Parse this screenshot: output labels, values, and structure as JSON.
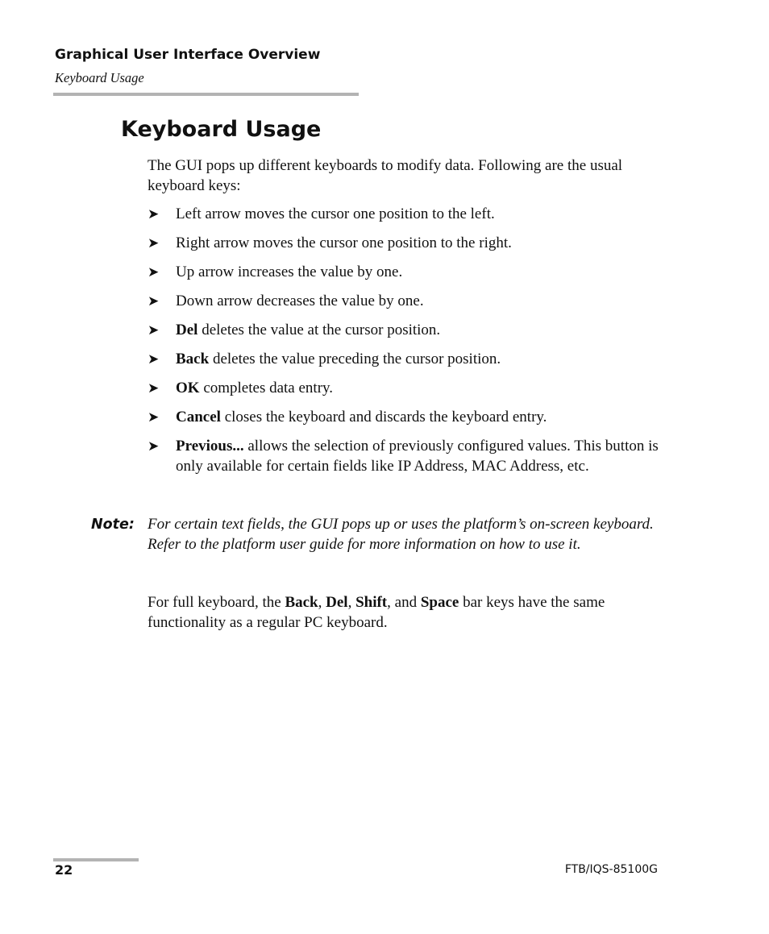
{
  "header": {
    "chapter": "Graphical User Interface Overview",
    "section": "Keyboard Usage"
  },
  "title": "Keyboard Usage",
  "intro": "The GUI pops up different keyboards to modify data. Following are the usual keyboard keys:",
  "bullet_icon": "arrowhead-right-icon",
  "bullets": [
    {
      "bold": "",
      "text": "Left arrow moves the cursor one position to the left."
    },
    {
      "bold": "",
      "text": "Right arrow moves the cursor one position to the right."
    },
    {
      "bold": "",
      "text": "Up arrow increases the value by one."
    },
    {
      "bold": "",
      "text": "Down arrow decreases the value by one."
    },
    {
      "bold": "Del",
      "text": " deletes the value at the cursor position."
    },
    {
      "bold": "Back",
      "text": " deletes the value preceding the cursor position."
    },
    {
      "bold": "OK",
      "text": " completes data entry."
    },
    {
      "bold": "Cancel",
      "text": " closes the keyboard and discards the keyboard entry."
    },
    {
      "bold": "Previous...",
      "text": " allows the selection of previously configured values. This button is only available for certain fields like IP Address, MAC Address, etc."
    }
  ],
  "note": {
    "label": "Note:",
    "text": "For certain text fields, the GUI pops up or uses the platform’s on-screen keyboard. Refer to the platform user guide for more information on how to use it."
  },
  "full_keyboard": {
    "prefix": "For full keyboard, the ",
    "key1": "Back",
    "sep1": ", ",
    "key2": "Del",
    "sep2": ", ",
    "key3": "Shift",
    "sep3": ", and ",
    "key4": "Space",
    "suffix": " bar keys have the same functionality as a regular PC keyboard."
  },
  "footer": {
    "page_number": "22",
    "document_id": "FTB/IQS-85100G"
  }
}
